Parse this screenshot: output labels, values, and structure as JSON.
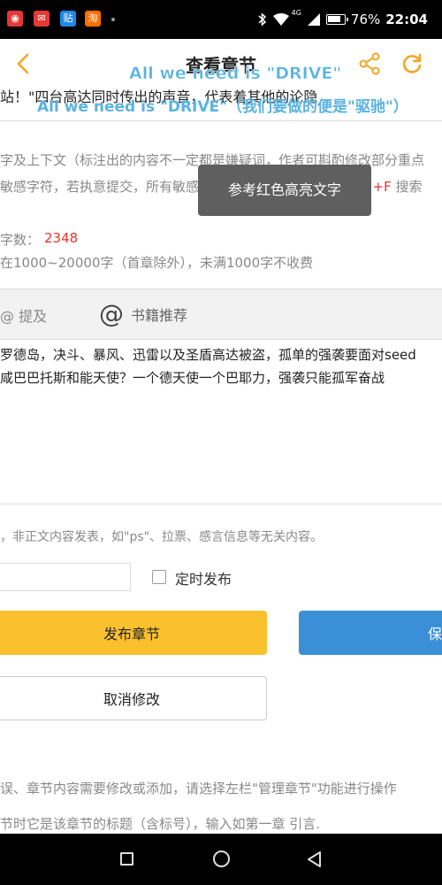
{
  "status_bar": {
    "battery": "76%",
    "time": "22:04",
    "network": "4G",
    "icons": [
      "app-netease-icon",
      "app-chat-icon",
      "app-tieba-icon",
      "app-taobao-icon",
      "bluetooth-icon",
      "wifi-icon",
      "signal-icon",
      "battery-icon"
    ],
    "app_glyphs": [
      "◉",
      "✉",
      "贴",
      "淘"
    ],
    "app_colors": [
      "#e53935",
      "#e53935",
      "#1e88e5",
      "#ff6f00"
    ]
  },
  "header": {
    "title": "查看章节",
    "accent_color": "#f5a623"
  },
  "overlay": {
    "line1": "All we need is \"DRIVE\"",
    "line2": "All we need is \"DRIVE\"（我们要做的便是\"驱驰\"）"
  },
  "chapter_title": "站！\"四台高达同时传出的声音，代表着其他的论隐",
  "hints": {
    "line1": "字及上下文（标注出的内容不一定都是嫌疑词，作者可斟酌修改部分重点",
    "line2_before": "敏感字符，若执意提交，所有敏感词将被隐藏，可用组合键 ",
    "line2_key": "Ctrl+F",
    "line2_after": " 搜索"
  },
  "toast": "参考红色高亮文字",
  "word_count": {
    "label": "字数：",
    "value": "2348",
    "note": "在1000~20000字（首章除外），未满1000字不收费"
  },
  "toolbar": {
    "mention_label": "@ 提及",
    "book_rec_label": "书籍推荐"
  },
  "content": {
    "line1": "罗德岛，决斗、暴风、迅雷以及圣盾高达被盗，孤单的强袭要面对seed",
    "line2": "咸巴巴托斯和能天使？一个德天使一个巴耶力，强袭只能孤军奋战"
  },
  "notice": "，非正文内容发表，如\"ps\"、拉票、感言信息等无关内容。",
  "schedule": {
    "time_value": "",
    "label": "定时发布"
  },
  "buttons": {
    "publish": "发布章节",
    "save": "保",
    "cancel": "取消修改"
  },
  "tips": {
    "line1": "误、章节内容需要修改或添加，请选择左栏\"管理章节\"功能进行操作",
    "line2": "节时它是该章节的标题（含标号），输入如第一章 引言."
  }
}
